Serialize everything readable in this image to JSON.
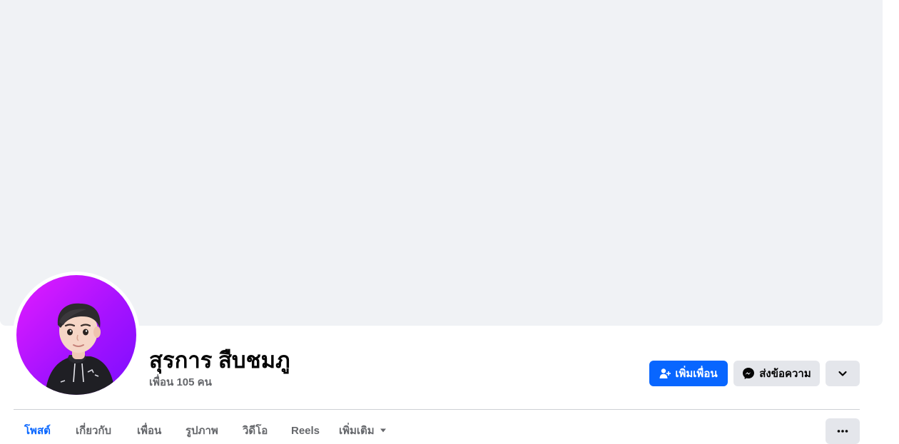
{
  "profile": {
    "name": "สุรการ สืบชมภู",
    "friends_count": "เพื่อน 105 คน"
  },
  "actions": {
    "add_friend": "เพิ่มเพื่อน",
    "message": "ส่งข้อความ"
  },
  "tabs": [
    {
      "label": "โพสต์",
      "active": true
    },
    {
      "label": "เกี่ยวกับ",
      "active": false
    },
    {
      "label": "เพื่อน",
      "active": false
    },
    {
      "label": "รูปภาพ",
      "active": false
    },
    {
      "label": "วิดีโอ",
      "active": false
    },
    {
      "label": "Reels",
      "active": false
    },
    {
      "label": "เพิ่มเติม",
      "active": false
    }
  ],
  "colors": {
    "accent": "#0866ff",
    "cover": "#f0f2f5",
    "secondary_button": "#e4e6eb",
    "muted_text": "#65676b"
  },
  "icons": {
    "add_friend": "person-add-icon",
    "message": "messenger-icon",
    "more_actions": "chevron-down-icon",
    "more_tab": "caret-down-icon",
    "tab_overflow": "ellipsis-icon"
  }
}
